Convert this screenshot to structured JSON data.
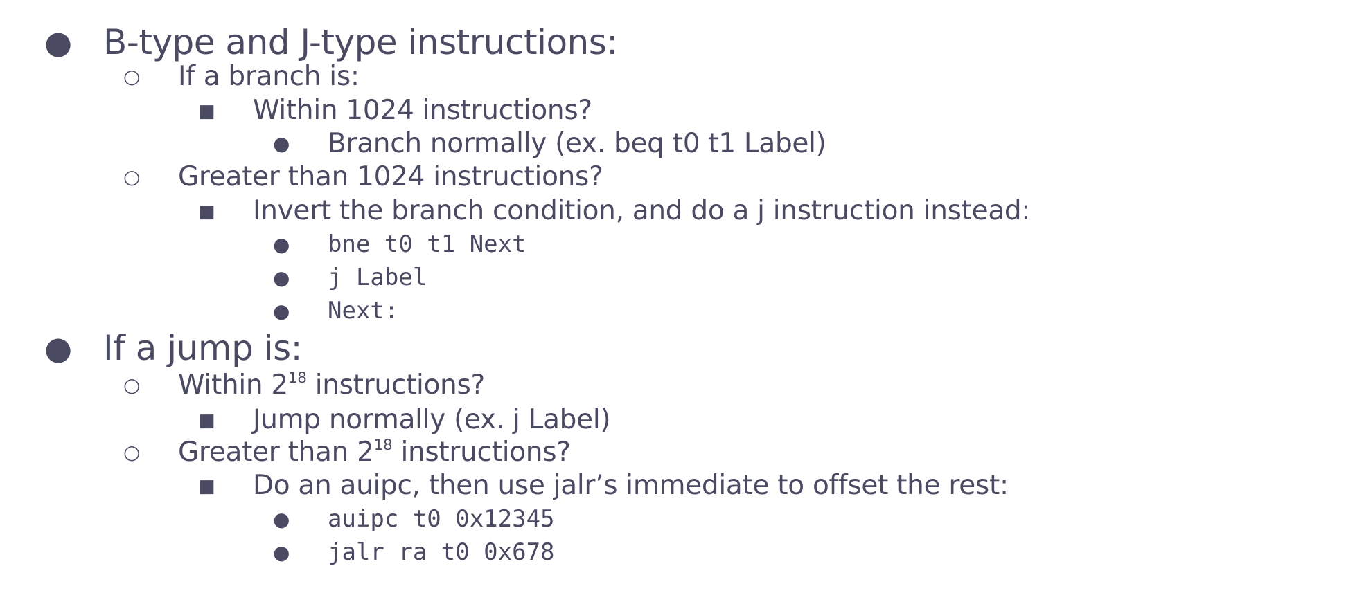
{
  "bullets": {
    "disc": "●",
    "circle": "○",
    "square": "■"
  },
  "items": [
    {
      "text": "B-type and J-type instructions:"
    },
    {
      "text": "If a branch is:"
    },
    {
      "text": "Within 1024 instructions?"
    },
    {
      "text": "Branch normally (ex. beq t0 t1 Label)"
    },
    {
      "text": "Greater than 1024 instructions?"
    },
    {
      "text": "Invert the branch condition, and do a j instruction instead:"
    },
    {
      "text": "bne t0 t1 Next"
    },
    {
      "text": "j Label"
    },
    {
      "text": "Next:"
    },
    {
      "text": "If a jump is:"
    },
    {
      "text_before": "Within 2",
      "sup": "18",
      "text_after": " instructions?"
    },
    {
      "text": "Jump normally (ex. j Label)"
    },
    {
      "text_before": "Greater than 2",
      "sup": "18",
      "text_after": " instructions?"
    },
    {
      "text": "Do an auipc, then use jalr’s immediate to offset the rest:"
    },
    {
      "text": "auipc t0 0x12345"
    },
    {
      "text": "jalr ra t0 0x678"
    }
  ]
}
